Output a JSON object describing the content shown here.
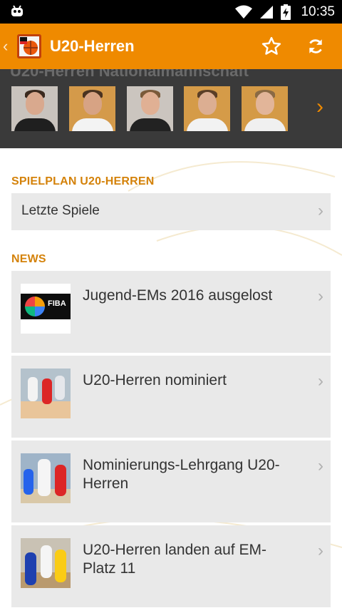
{
  "status_bar": {
    "time": "10:35"
  },
  "app_bar": {
    "title": "U20-Herren"
  },
  "player_strip": {
    "title": "U20-Herren Nationalmannschaft",
    "player_count": 5
  },
  "schedule": {
    "title": "SPIELPLAN U20-HERREN",
    "item": "Letzte Spiele"
  },
  "news": {
    "title": "NEWS",
    "items": [
      {
        "title": "Jugend-EMs 2016 ausgelost",
        "thumb": "fiba-logo"
      },
      {
        "title": "U20-Herren nominiert",
        "thumb": "basketball-photo"
      },
      {
        "title": "Nominierungs-Lehrgang U20-Herren",
        "thumb": "basketball-photo"
      },
      {
        "title": "U20-Herren landen auf EM-Platz 11",
        "thumb": "basketball-photo"
      }
    ],
    "fiba_text": "FIBA"
  },
  "colors": {
    "accent": "#ef8a00",
    "section": "#d4820a",
    "card": "#e9e9e9",
    "strip": "#3a3a3a"
  }
}
